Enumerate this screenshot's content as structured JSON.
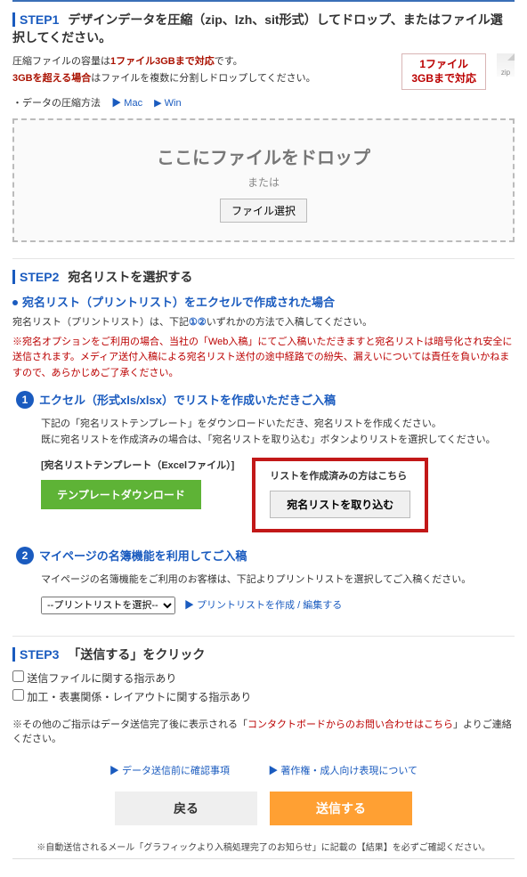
{
  "step1": {
    "label": "STEP1",
    "title": "デザインデータを圧縮（zip、lzh、sit形式）してドロップ、またはファイル選択してください。",
    "intro_l1_prefix": "圧縮ファイルの容量は",
    "intro_l1_strong": "1ファイル3GBまで対応",
    "intro_l1_suffix": "です。",
    "intro_l2_strong": "3GBを超える場合",
    "intro_l2_suffix": "はファイルを複数に分割しドロップしてください。",
    "badge_l1": "1ファイル",
    "badge_l2": "3GBまで対応",
    "zip_ext": "zip",
    "compress_label": "・データの圧縮方法",
    "link_mac": "▶ Mac",
    "link_win": "▶ Win",
    "dz_title": "ここにファイルをドロップ",
    "dz_or": "または",
    "dz_btn": "ファイル選択"
  },
  "step2": {
    "label": "STEP2",
    "title": "宛名リストを選択する",
    "sub_head": "宛名リスト（プリントリスト）をエクセルで作成された場合",
    "desc_prefix": "宛名リスト（プリントリスト）は、下記",
    "num1": "①",
    "num2": "②",
    "desc_suffix": "いずれかの方法で入稿してください。",
    "red_note": "※宛名オプションをご利用の場合、当社の「Web入稿」にてご入稿いただきますと宛名リストは暗号化され安全に送信されます。メディア送付入稿による宛名リスト送付の途中経路での紛失、漏えいについては責任を負いかねますので、あらかじめご了承ください。",
    "m1_num": "1",
    "m1_title": "エクセル（形式xls/xlsx）でリストを作成いただきご入稿",
    "m1_body1": "下記の「宛名リストテンプレート」をダウンロードいただき、宛名リストを作成ください。",
    "m1_body2": "既に宛名リストを作成済みの場合は、「宛名リストを取り込む」ボタンよりリストを選択してください。",
    "tpl_label": "[宛名リストテンプレート（Excelファイル）]",
    "tpl_btn": "テンプレートダウンロード",
    "import_label": "リストを作成済みの方はこちら",
    "import_btn": "宛名リストを取り込む",
    "m2_num": "2",
    "m2_title": "マイページの名簿機能を利用してご入稿",
    "m2_body": "マイページの名簿機能をご利用のお客様は、下記よりプリントリストを選択してご入稿ください。",
    "select_placeholder": "--プリントリストを選択--",
    "edit_link": "▶ プリントリストを作成 / 編集する"
  },
  "step3": {
    "label": "STEP3",
    "title": "「送信する」をクリック",
    "cb1": "送信ファイルに関する指示あり",
    "cb2": "加工・表裏関係・レイアウトに関する指示あり",
    "footnote_prefix": "※その他のご指示はデータ送信完了後に表示される「",
    "footnote_link": "コンタクトボードからのお問い合わせはこちら",
    "footnote_suffix": "」よりご連絡ください。",
    "info1": "▶ データ送信前に確認事項",
    "info2": "▶ 著作権・成人向け表現について",
    "btn_back": "戻る",
    "btn_submit": "送信する",
    "final_note": "※自動送信されるメール「グラフィックより入稿処理完了のお知らせ」に記載の【結果】を必ずご確認ください。"
  }
}
